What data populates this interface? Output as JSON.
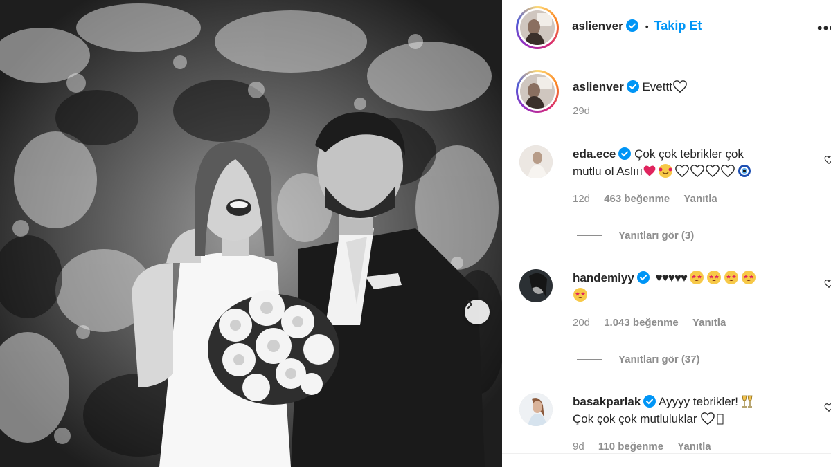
{
  "post": {
    "author": "aslienver",
    "follow_label": "Takip Et",
    "dot": "•",
    "more_label": "•••"
  },
  "caption": {
    "username": "aslienver",
    "text": "Evettt",
    "time": "29d"
  },
  "comments": [
    {
      "username": "eda.ece",
      "text_line1": "Çok çok tebrikler çok",
      "text_line2": "mutlu ol Aslııı",
      "time": "12d",
      "likes": "463 beğenme",
      "reply": "Yanıtla",
      "view_replies": "Yanıtları gör (3)"
    },
    {
      "username": "handemiyy",
      "text_line1": "♥♥♥♥♥",
      "time": "20d",
      "likes": "1.043 beğenme",
      "reply": "Yanıtla",
      "view_replies": "Yanıtları gör (37)"
    },
    {
      "username": "basakparlak",
      "text_line1": "Ayyyy tebrikler!",
      "text_line2": "Çok çok çok mutluluklar",
      "time": "9d",
      "likes": "110 beğenme",
      "reply": "Yanıtla"
    }
  ],
  "colors": {
    "accent": "#0095f6",
    "verified": "#0095f6",
    "muted": "#8e8e8e",
    "text": "#262626"
  },
  "icons": [
    "verified-badge-icon",
    "more-options-icon",
    "heart-outline-icon",
    "chevron-right-icon"
  ]
}
